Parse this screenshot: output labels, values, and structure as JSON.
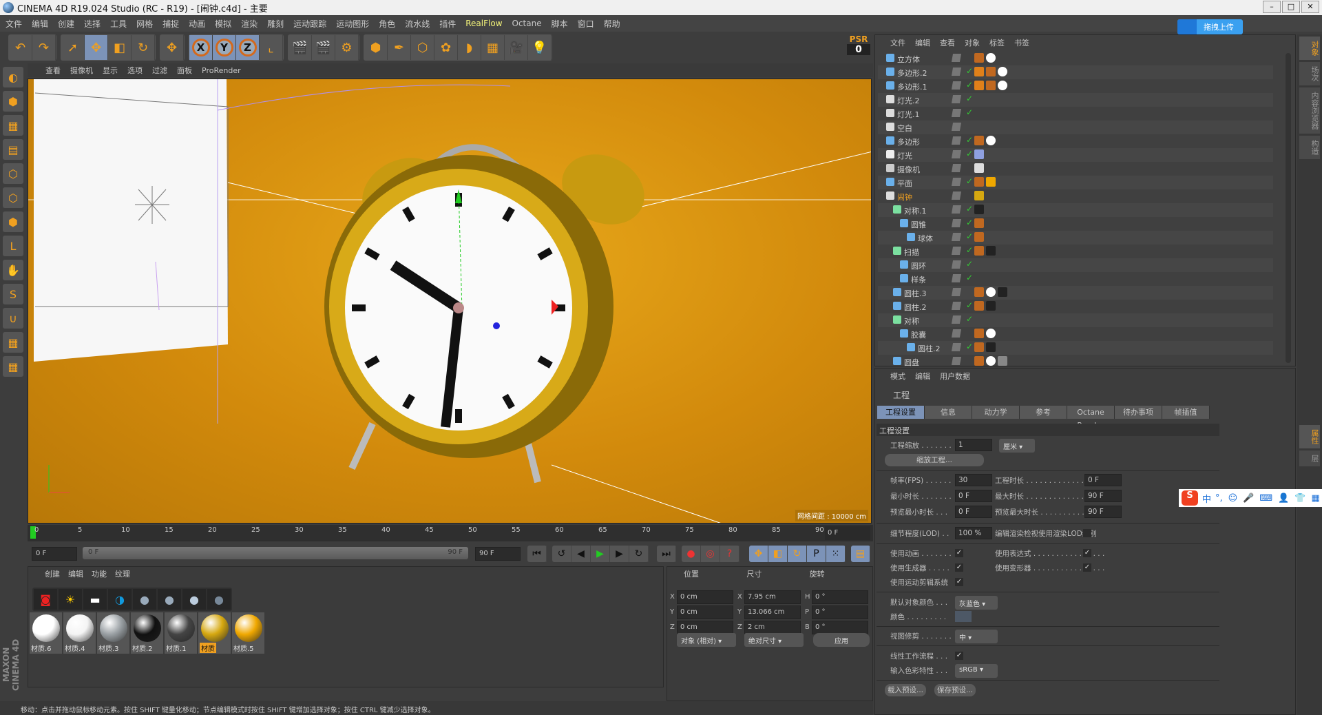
{
  "window": {
    "title": "CINEMA 4D R19.024 Studio (RC - R19) - [闹钟.c4d] - 主要",
    "buttons": [
      "–",
      "□",
      "✕"
    ]
  },
  "menu": [
    "文件",
    "编辑",
    "创建",
    "选择",
    "工具",
    "网格",
    "捕捉",
    "动画",
    "模拟",
    "渲染",
    "雕刻",
    "运动跟踪",
    "运动图形",
    "角色",
    "流水线",
    "插件",
    "RealFlow",
    "Octane",
    "脚本",
    "窗口",
    "帮助"
  ],
  "upload_label": "拖拽上传",
  "toolbar": {
    "groups": [
      [
        "undo-icon",
        "redo-icon"
      ],
      [
        "select-icon",
        "move-icon",
        "scale-icon",
        "rotate-icon"
      ],
      [
        "transform-icon"
      ],
      [
        "x-axis-icon",
        "y-axis-icon",
        "z-axis-icon",
        "coord-system-icon"
      ],
      [
        "render-view-icon",
        "render-picture-icon",
        "render-settings-icon"
      ],
      [
        "cube-icon",
        "pen-icon",
        "subdivision-icon",
        "cloner-icon",
        "deformer-icon",
        "floor-icon",
        "camera-icon",
        "light-icon"
      ]
    ],
    "axis_labels": [
      "X",
      "Y",
      "Z"
    ],
    "psr_label": "PSR",
    "psr_value": "0"
  },
  "viewport": {
    "menu": [
      "查看",
      "摄像机",
      "显示",
      "选项",
      "过滤",
      "面板",
      "ProRender"
    ],
    "grid_info": "网格间距 : 10000 cm",
    "bg_color": "#d9930f"
  },
  "timeline": {
    "ticks": [
      "0",
      "5",
      "10",
      "15",
      "20",
      "25",
      "30",
      "35",
      "40",
      "45",
      "50",
      "55",
      "60",
      "65",
      "70",
      "75",
      "80",
      "85",
      "90"
    ],
    "current": "0 F",
    "start": "0 F",
    "scrub_start": "0 F",
    "scrub_end": "90 F",
    "end": "90 F"
  },
  "materials": {
    "menu": [
      "创建",
      "编辑",
      "功能",
      "纹理"
    ],
    "items": [
      {
        "name": "材质.6",
        "color": "#ffffff"
      },
      {
        "name": "材质.4",
        "color": "#f4f4f4"
      },
      {
        "name": "材质.3",
        "color": "#9aa0a4"
      },
      {
        "name": "材质.2",
        "color": "#111111"
      },
      {
        "name": "材质.1",
        "color": "#444444"
      },
      {
        "name": "材质",
        "color": "#d6a810",
        "selected": true
      },
      {
        "name": "材质.5",
        "color": "#f0a800"
      }
    ]
  },
  "coords": {
    "headers": [
      "位置",
      "尺寸",
      "旋转"
    ],
    "rows": [
      {
        "axis": "X",
        "pos": "0 cm",
        "size_axis": "X",
        "size": "7.95 cm",
        "rot_axis": "H",
        "rot": "0 °"
      },
      {
        "axis": "Y",
        "pos": "0 cm",
        "size_axis": "Y",
        "size": "13.066 cm",
        "rot_axis": "P",
        "rot": "0 °"
      },
      {
        "axis": "Z",
        "pos": "0 cm",
        "size_axis": "Z",
        "size": "2 cm",
        "rot_axis": "B",
        "rot": "0 °"
      }
    ],
    "mode": "对象 (相对)",
    "size_mode": "绝对尺寸",
    "apply": "应用"
  },
  "status": "移动：点击并拖动鼠标移动元素。按住 SHIFT 键量化移动；节点编辑模式时按住 SHIFT 键增加选择对象；按住 CTRL 键减少选择对象。",
  "objects": {
    "menu": [
      "文件",
      "编辑",
      "查看",
      "对象",
      "标签",
      "书签"
    ],
    "items": [
      {
        "name": "立方体",
        "depth": 0,
        "icon": "#6ab0ea",
        "check": false,
        "tags": [
          "#c06820",
          "#ffffff"
        ]
      },
      {
        "name": "多边形.2",
        "depth": 0,
        "icon": "#6ab0ea",
        "check": true,
        "tags": [
          "#e0801a",
          "#c06820",
          "#ffffff"
        ]
      },
      {
        "name": "多边形.1",
        "depth": 0,
        "icon": "#6ab0ea",
        "check": true,
        "tags": [
          "#e0801a",
          "#c06820",
          "#ffffff"
        ]
      },
      {
        "name": "灯光.2",
        "depth": 0,
        "icon": "#dddddd",
        "check": true,
        "tags": []
      },
      {
        "name": "灯光.1",
        "depth": 0,
        "icon": "#dddddd",
        "check": true,
        "tags": []
      },
      {
        "name": "空白",
        "depth": 0,
        "icon": "#dddddd",
        "check": false,
        "tags": []
      },
      {
        "name": "多边形",
        "depth": 0,
        "icon": "#6ab0ea",
        "check": true,
        "tags": [
          "#c06820",
          "#ffffff"
        ]
      },
      {
        "name": "灯光",
        "depth": 0,
        "icon": "#eeeeee",
        "check": true,
        "tags": [
          "#8fa0e0"
        ]
      },
      {
        "name": "摄像机",
        "depth": 0,
        "icon": "#cccccc",
        "check": false,
        "tags": [
          "#dddddd"
        ]
      },
      {
        "name": "平面",
        "depth": 0,
        "icon": "#6ab0ea",
        "check": true,
        "tags": [
          "#c06820",
          "#f0a800"
        ]
      },
      {
        "name": "闹钟",
        "depth": 0,
        "icon": "#dddddd",
        "check": false,
        "highlight": true,
        "tags": [
          "#d6a810"
        ]
      },
      {
        "name": "对称.1",
        "depth": 1,
        "icon": "#7be0a0",
        "check": true,
        "tags": [
          "#222222"
        ]
      },
      {
        "name": "圆锥",
        "depth": 2,
        "icon": "#6ab0ea",
        "check": true,
        "tags": [
          "#c06820"
        ]
      },
      {
        "name": "球体",
        "depth": 3,
        "icon": "#6ab0ea",
        "check": true,
        "tags": [
          "#c06820"
        ]
      },
      {
        "name": "扫描",
        "depth": 1,
        "icon": "#7be0a0",
        "check": true,
        "tags": [
          "#c06820",
          "#222222"
        ]
      },
      {
        "name": "圆环",
        "depth": 2,
        "icon": "#6ab0ea",
        "check": true,
        "tags": []
      },
      {
        "name": "样条",
        "depth": 2,
        "icon": "#6ab0ea",
        "check": true,
        "tags": []
      },
      {
        "name": "圆柱.3",
        "depth": 1,
        "icon": "#6ab0ea",
        "check": false,
        "tags": [
          "#c06820",
          "#ffffff",
          "#222222"
        ]
      },
      {
        "name": "圆柱.2",
        "depth": 1,
        "icon": "#6ab0ea",
        "check": true,
        "tags": [
          "#c06820",
          "#222222"
        ]
      },
      {
        "name": "对称",
        "depth": 1,
        "icon": "#7be0a0",
        "check": true,
        "tags": []
      },
      {
        "name": "胶囊",
        "depth": 2,
        "icon": "#6ab0ea",
        "check": false,
        "tags": [
          "#c06820",
          "#ffffff"
        ]
      },
      {
        "name": "圆柱.2",
        "depth": 3,
        "icon": "#6ab0ea",
        "check": true,
        "tags": [
          "#c06820",
          "#222222"
        ]
      },
      {
        "name": "圆盘",
        "depth": 1,
        "icon": "#6ab0ea",
        "check": false,
        "tags": [
          "#c06820",
          "#ffffff",
          "#888888"
        ]
      }
    ]
  },
  "attributes": {
    "menu": [
      "模式",
      "编辑",
      "用户数据"
    ],
    "title": "工程",
    "tabs": [
      "工程设置",
      "信息",
      "动力学",
      "参考",
      "Octane Render",
      "待办事项",
      "帧插值"
    ],
    "section": "工程设置",
    "scale_label": "工程缩放 . . . . . . .",
    "scale_value": "1",
    "scale_unit": "厘米",
    "scale_button": "缩放工程...",
    "fps_label": "帧率(FPS) . . . . . .",
    "fps": "30",
    "doc_time_label": "工程时长 . . . . . . . . . . . . . . . . .",
    "doc_time": "0 F",
    "min_label": "最小时长 . . . . . . .",
    "min": "0 F",
    "max_label": "最大时长 . . . . . . . . . . . . . . . . .",
    "max": "90 F",
    "pmin_label": "预览最小时长 . . .",
    "pmin": "0 F",
    "pmax_label": "预览最大时长 . . . . . . . . . . . . . .",
    "pmax": "90 F",
    "lod_label": "细节程度(LOD) . .",
    "lod": "100 %",
    "render_lod_label": "编辑渲染检视使用渲染LOD级别",
    "use_anim": "使用动画 . . . . . . .",
    "use_expr": "使用表达式 . . . . . . . . . . . . . . . .",
    "use_gen": "使用生成器 . . . . .",
    "use_deform": "使用变形器 . . . . . . . . . . . . . . . .",
    "use_motion": "使用运动剪辑系统",
    "def_color_label": "默认对象颜色 . . .",
    "def_color": "灰蓝色",
    "color_label": "颜色 . . . . . . . . .",
    "color_swatch": "#4d5866",
    "clip_label": "视图修剪 . . . . . . .",
    "clip": "中",
    "linear_label": "线性工作流程 . . .",
    "input_color_label": "输入色彩特性 . . .",
    "input_color": "sRGB",
    "load_preset": "载入预设...",
    "save_preset": "保存预设...",
    "check": "✓"
  },
  "right_tabs": [
    "对象",
    "场次",
    "内容浏览器",
    "构造"
  ],
  "right_tabs_attr": [
    "属性",
    "层"
  ],
  "ime": {
    "logo": "S",
    "lang": "中",
    "items": [
      "°,",
      "☺",
      "🎤",
      "⌨",
      "👤",
      "👕",
      "▦"
    ]
  }
}
